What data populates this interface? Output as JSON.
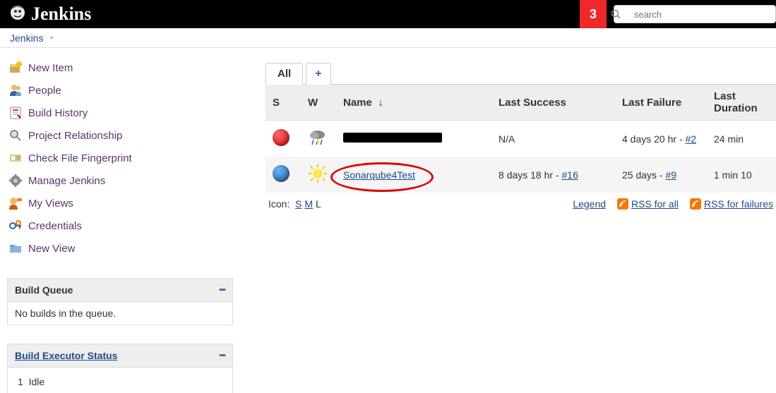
{
  "header": {
    "logo_text": "Jenkins",
    "alert_count": "3",
    "search_placeholder": "search"
  },
  "breadcrumbs": [
    {
      "label": "Jenkins"
    }
  ],
  "sidebar": {
    "nav": [
      {
        "label": "New Item",
        "icon": "new-item"
      },
      {
        "label": "People",
        "icon": "people"
      },
      {
        "label": "Build History",
        "icon": "history"
      },
      {
        "label": "Project Relationship",
        "icon": "search"
      },
      {
        "label": "Check File Fingerprint",
        "icon": "fingerprint"
      },
      {
        "label": "Manage Jenkins",
        "icon": "gear"
      },
      {
        "label": "My Views",
        "icon": "views"
      },
      {
        "label": "Credentials",
        "icon": "credentials"
      },
      {
        "label": "New View",
        "icon": "folder"
      }
    ],
    "queue": {
      "title": "Build Queue",
      "empty_text": "No builds in the queue."
    },
    "executor": {
      "title": "Build Executor Status",
      "rows": [
        {
          "num": "1",
          "status": "Idle"
        }
      ]
    }
  },
  "content": {
    "tabs": [
      {
        "label": "All",
        "active": true
      }
    ],
    "add_tab_label": "+",
    "columns": {
      "s": "S",
      "w": "W",
      "name": "Name",
      "sort": "↓",
      "last_success": "Last Success",
      "last_failure": "Last Failure",
      "last_duration": "Last Duration"
    },
    "jobs": [
      {
        "status": "red",
        "weather": "storm",
        "name_redacted": true,
        "name": "",
        "last_success_text": "N/A",
        "last_success_build": "",
        "last_failure_text": "4 days 20 hr - ",
        "last_failure_build": "#2",
        "duration": "24 min",
        "circled": false
      },
      {
        "status": "blue",
        "weather": "sun",
        "name_redacted": false,
        "name": "Sonarqube4Test",
        "last_success_text": "8 days 18 hr - ",
        "last_success_build": "#16",
        "last_failure_text": "25 days - ",
        "last_failure_build": "#9",
        "duration": "1 min 10",
        "circled": true
      }
    ],
    "icon_label": "Icon:",
    "icon_sizes": {
      "s": "S",
      "m": "M",
      "l": "L",
      "selected": "L"
    },
    "footer_links": {
      "legend": "Legend",
      "rss_all": "RSS for all",
      "rss_fail": "RSS for failures"
    }
  }
}
